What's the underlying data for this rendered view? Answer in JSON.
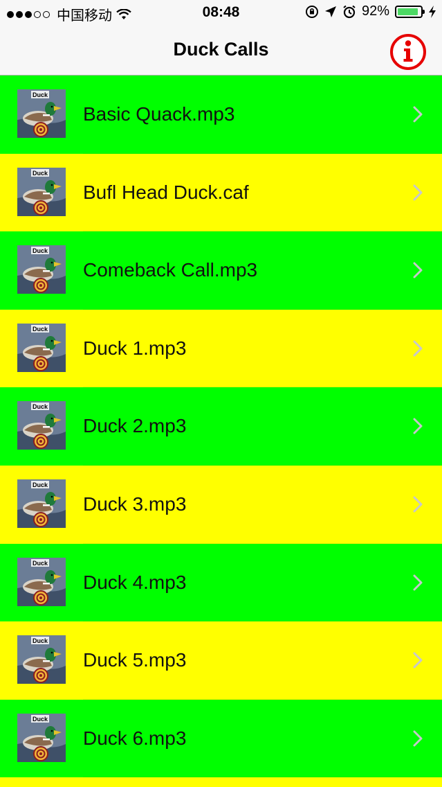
{
  "status_bar": {
    "carrier": "中国移动",
    "time": "08:48",
    "battery_percent": "92%",
    "battery_level": 0.92
  },
  "nav": {
    "title": "Duck Calls",
    "info_icon": "info-icon",
    "info_color": "#e60000"
  },
  "thumbnail_text": "Duck",
  "rows": [
    {
      "label": "Basic Quack.mp3",
      "color": "green"
    },
    {
      "label": "Bufl Head Duck.caf",
      "color": "yellow"
    },
    {
      "label": "Comeback Call.mp3",
      "color": "green"
    },
    {
      "label": "Duck 1.mp3",
      "color": "yellow"
    },
    {
      "label": "Duck 2.mp3",
      "color": "green"
    },
    {
      "label": "Duck 3.mp3",
      "color": "yellow"
    },
    {
      "label": "Duck 4.mp3",
      "color": "green"
    },
    {
      "label": "Duck 5.mp3",
      "color": "yellow"
    },
    {
      "label": "Duck 6.mp3",
      "color": "green"
    }
  ],
  "colors": {
    "row_green": "#00ff00",
    "row_yellow": "#ffff00",
    "chevron": "#c7c7cc",
    "nav_background": "#f7f7f7"
  }
}
